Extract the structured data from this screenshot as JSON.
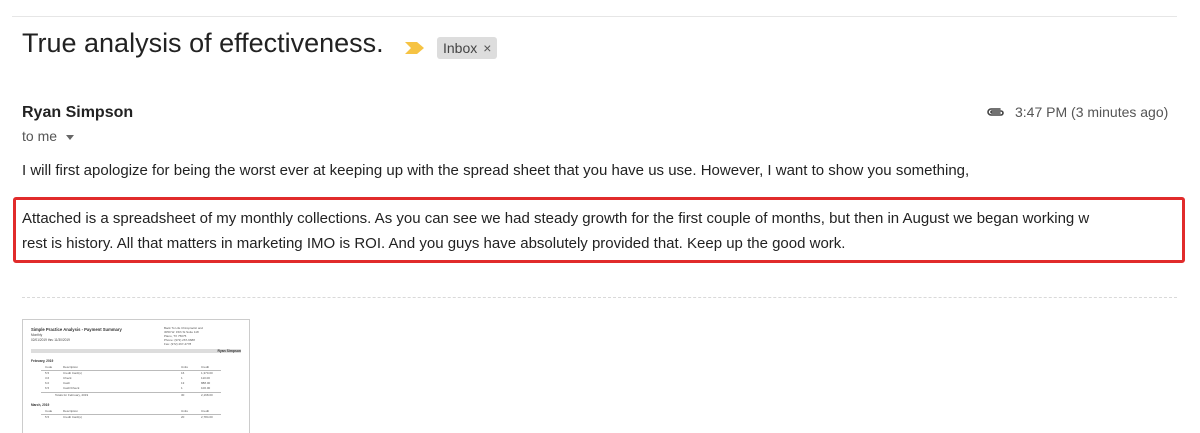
{
  "email": {
    "subject": "True analysis of effectiveness.",
    "label": "Inbox",
    "label_close": "×",
    "sender": "Ryan Simpson",
    "recipient": "to me",
    "timestamp": "3:47 PM (3 minutes ago)",
    "paragraphs": [
      "I will first apologize for being the worst ever at keeping up with the spread sheet that you have us use. However, I want to show you something,",
      "Attached is a spreadsheet of my monthly collections. As you can see we had steady growth for the first couple of months, but then in August we began working w",
      "rest is history.  All that matters in marketing IMO is ROI.  And you guys have absolutely provided that.  Keep up the good work."
    ]
  },
  "attachment": {
    "title": "Simple Practice Analysis - Payment Summary",
    "period": "Monthly",
    "range": "02/01/2019 thru 11/30/2019",
    "address": [
      "Back To Life Chiropractic and",
      "3050 W. 15th St Suite 118",
      "Plano, TX 75075",
      "Phone: (972) 267-9688",
      "Fax: (972) 267-4778"
    ],
    "owner": "Ryan Simpson",
    "sections": [
      {
        "month": "February, 2019",
        "headers": [
          "Code",
          "Description",
          "Units",
          "Credit"
        ],
        "rows": [
          [
            "5.5",
            "Credit Card(s)",
            "16",
            "1,370.00"
          ],
          [
            "3.6",
            "Check",
            "1",
            "110.00"
          ],
          [
            "6.0",
            "Cash",
            "13",
            "888.00"
          ],
          [
            "6.5",
            "Cash/Check",
            "1",
            "100.00"
          ]
        ],
        "total": [
          "Totals for February, 2019",
          "30",
          "2,168.00"
        ]
      },
      {
        "month": "March, 2019",
        "headers": [
          "Code",
          "Description",
          "Units",
          "Credit"
        ],
        "rows": [
          [
            "5.5",
            "Credit Card(s)",
            "20",
            "2,784.00"
          ]
        ]
      }
    ]
  },
  "colors": {
    "highlight_border": "#e12b2b",
    "importance_marker": "#f6c343",
    "label_bg": "#dddddd"
  },
  "icons": [
    "importance-marker-icon",
    "close-icon",
    "chevron-down-icon",
    "paperclip-icon"
  ]
}
